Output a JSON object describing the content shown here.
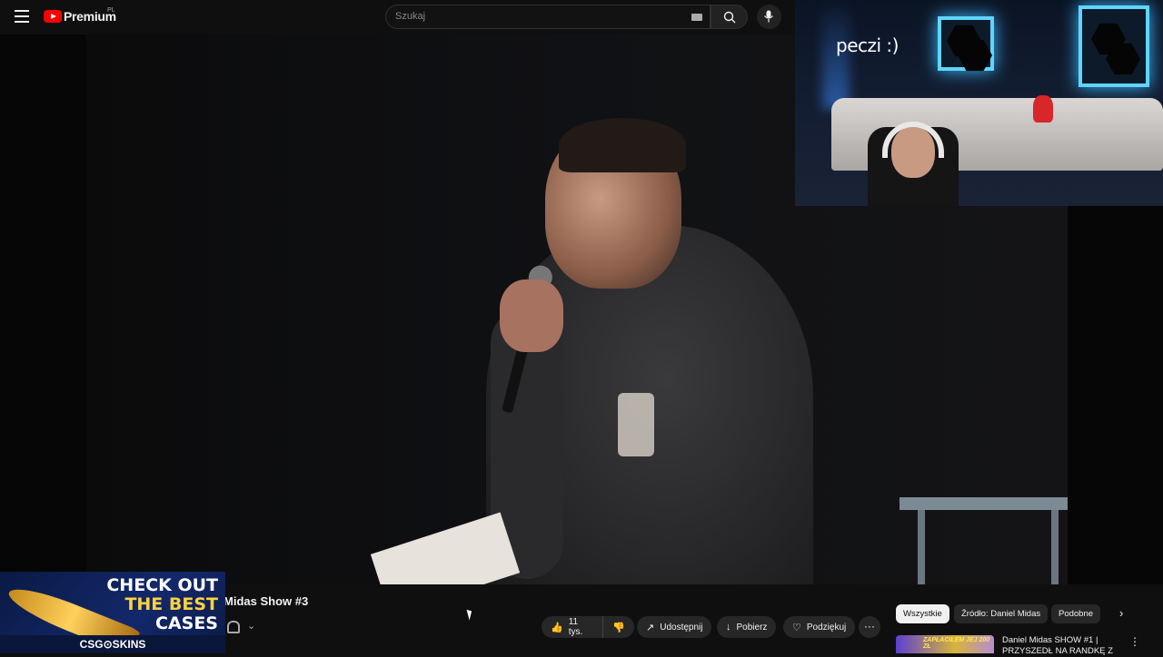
{
  "header": {
    "logo_text": "Premium",
    "logo_region": "PL",
    "search_placeholder": "Szukaj",
    "icons": [
      "menu-icon",
      "keyboard-icon",
      "search-icon",
      "mic-icon"
    ]
  },
  "webcam": {
    "overlay_text": "peczi :)"
  },
  "video": {
    "title": "Midas Show #3"
  },
  "actions": {
    "like_count": "11 tys.",
    "share_label": "Udostępnij",
    "download_label": "Pobierz",
    "thanks_label": "Podziękuj",
    "more_label": "···"
  },
  "chips": [
    {
      "label": "Wszystkie",
      "active": true
    },
    {
      "label": "Źródło: Daniel Midas",
      "active": false
    },
    {
      "label": "Podobne",
      "active": false
    }
  ],
  "recommendation": {
    "thumb_text": "ZAPŁACIŁEM JEJ 200 ZŁ",
    "title": "Daniel Midas SHOW #1 | PRZYSZEDŁ NA RANDKĘ Z"
  },
  "ad": {
    "line1": "CHECK OUT",
    "line2": "THE BEST",
    "line3": "CASES",
    "brand": "CSG⊙SKINS"
  },
  "colors": {
    "background": "#0f0f0f",
    "youtube_red": "#ff0000",
    "pill_bg": "#272727",
    "accent_neon": "#5fd5ff"
  }
}
